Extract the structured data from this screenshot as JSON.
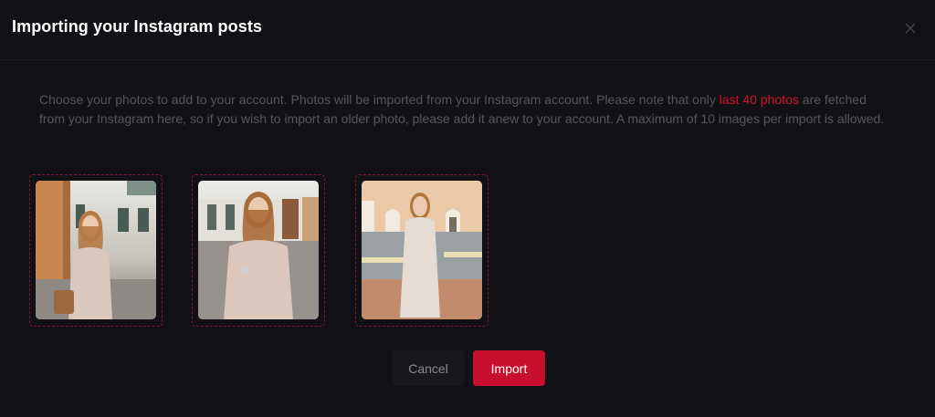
{
  "dialog": {
    "title": "Importing your Instagram posts",
    "description_before": "Choose your photos to add to your account. Photos will be imported from your Instagram account. Please note that only ",
    "description_highlight": "last 40 photos",
    "description_after": " are fetched from your Instagram here, so if you wish to import an older photo, please add it anew to your account. A maximum of 10 images per import is allowed.",
    "close_icon": "close-icon"
  },
  "photos": [
    {
      "icon": "instagram-photo-1"
    },
    {
      "icon": "instagram-photo-2"
    },
    {
      "icon": "instagram-photo-3"
    }
  ],
  "actions": {
    "cancel_label": "Cancel",
    "import_label": "Import"
  },
  "colors": {
    "background": "#121216",
    "accent": "#c8102e",
    "highlight_text": "#d3122c",
    "muted_text": "#55555e",
    "photo_border": "#7a1a2e"
  }
}
